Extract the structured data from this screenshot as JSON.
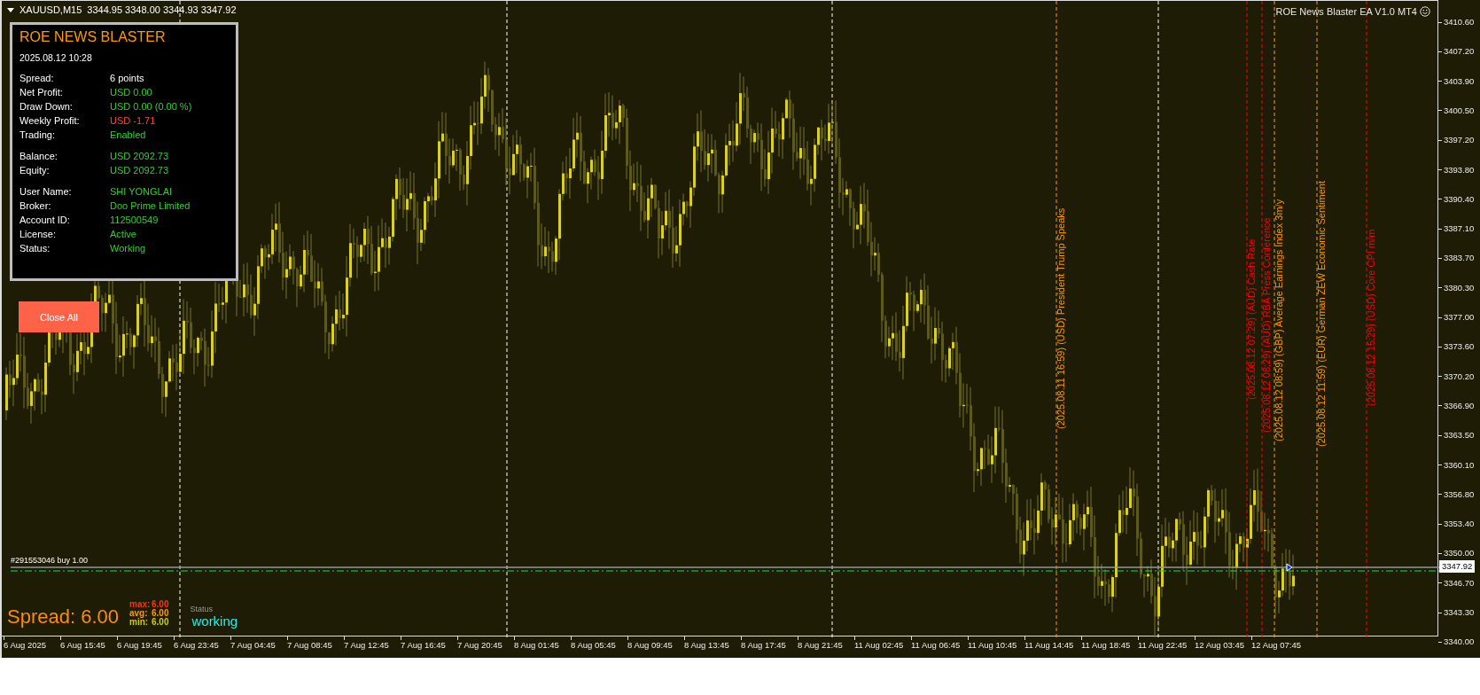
{
  "symbol_bar": {
    "symbol": "XAUUSD,M15",
    "quotes": "3344.95 3348.00 3344.93 3347.92"
  },
  "ea_label": "ROE News Blaster EA V1.0 MT4",
  "panel": {
    "title": "ROE NEWS BLASTER",
    "datetime": "2025.08.12 10:28",
    "groups": [
      [
        {
          "label": "Spread:",
          "value": "6 points",
          "color": "#ffffff"
        },
        {
          "label": "Net Profit:",
          "value": "USD 0.00",
          "color": "#33cc33"
        },
        {
          "label": "Draw Down:",
          "value": "USD 0.00 (0.00 %)",
          "color": "#33cc33"
        },
        {
          "label": "Weekly Profit:",
          "value": "USD -1.71",
          "color": "#ff4433"
        },
        {
          "label": "Trading:",
          "value": "Enabled",
          "color": "#33cc33"
        }
      ],
      [
        {
          "label": "Balance:",
          "value": "USD 2092.73",
          "color": "#33cc33"
        },
        {
          "label": "Equity:",
          "value": "USD 2092.73",
          "color": "#33cc33"
        }
      ],
      [
        {
          "label": "User Name:",
          "value": "SHI YONGLAI",
          "color": "#33cc33"
        },
        {
          "label": "Broker:",
          "value": "Doo Prime Limited",
          "color": "#33cc33"
        },
        {
          "label": "Account ID:",
          "value": "112500549",
          "color": "#33cc33"
        },
        {
          "label": "License:",
          "value": "Active",
          "color": "#33cc33"
        },
        {
          "label": "Status:",
          "value": "Working",
          "color": "#33cc33"
        }
      ]
    ]
  },
  "close_all_button": "Close All",
  "news_events": [
    {
      "text": "(2025.08.11 16:59) (USD) President Trump Speaks",
      "color": "#ff9900"
    },
    {
      "text": "(2025.08.12 07:29) (AUD) Cash Rate",
      "color": "#ff0000"
    },
    {
      "text": "(2025.08.12 08:29) (AUD) RBA Press Conference",
      "color": "#ff0000"
    },
    {
      "text": "(2025.08.12 08:59) (GBP) Average Earnings Index 3m/y",
      "color": "#ff9900"
    },
    {
      "text": "(2025.08.12 11:59) (EUR) German ZEW Economic Sentiment",
      "color": "#ff9900"
    },
    {
      "text": "(2025.08.12 15:29) (USD) Core CPI m/m",
      "color": "#ff0000"
    }
  ],
  "order_label": "#291553046 buy 1.00",
  "spread_widget": {
    "label": "Spread: 6.00",
    "stats": [
      {
        "label": "max:",
        "value": "6.00",
        "color": "#ff3300"
      },
      {
        "label": "avg:",
        "value": "6.00",
        "color": "#ff9900"
      },
      {
        "label": "min:",
        "value": "6.00",
        "color": "#cccc00"
      }
    ],
    "status_label": "Status",
    "status": "working"
  },
  "price_axis": {
    "labels": [
      "3410.60",
      "3407.20",
      "3403.90",
      "3400.50",
      "3397.20",
      "3393.80",
      "3390.40",
      "3387.10",
      "3383.70",
      "3380.30",
      "3377.00",
      "3373.60",
      "3370.20",
      "3366.90",
      "3363.50",
      "3360.10",
      "3356.80",
      "3353.40",
      "3350.00",
      "3346.70",
      "3343.30",
      "3340.00"
    ],
    "current_price": "3347.92"
  },
  "time_axis": {
    "labels": [
      "6 Aug 2025",
      "6 Aug 15:45",
      "6 Aug 19:45",
      "6 Aug 23:45",
      "7 Aug 04:45",
      "7 Aug 08:45",
      "7 Aug 12:45",
      "7 Aug 16:45",
      "7 Aug 20:45",
      "8 Aug 01:45",
      "8 Aug 05:45",
      "8 Aug 09:45",
      "8 Aug 13:45",
      "8 Aug 17:45",
      "8 Aug 21:45",
      "11 Aug 02:45",
      "11 Aug 06:45",
      "11 Aug 10:45",
      "11 Aug 14:45",
      "11 Aug 18:45",
      "11 Aug 22:45",
      "12 Aug 03:45",
      "12 Aug 07:45"
    ]
  }
}
